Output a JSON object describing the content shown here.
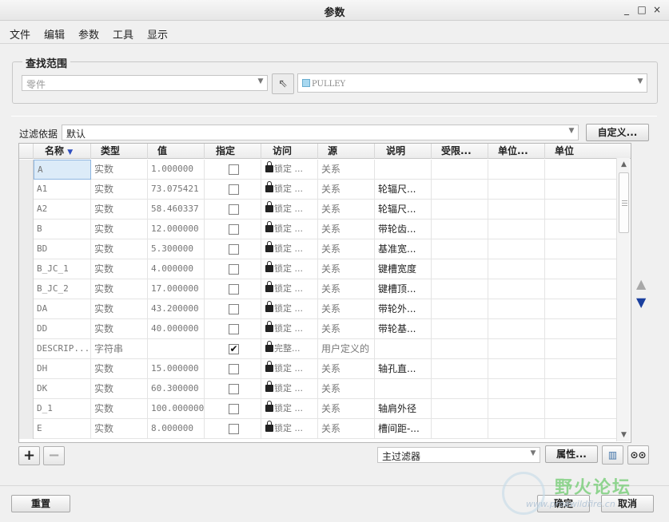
{
  "window": {
    "title": "参数",
    "controls": [
      "_",
      "□",
      "×"
    ]
  },
  "menu": [
    "文件",
    "编辑",
    "参数",
    "工具",
    "显示"
  ],
  "scope": {
    "group_label": "查找范围",
    "type_value": "零件",
    "model_value": "PULLEY"
  },
  "filter": {
    "label": "过滤依据",
    "value": "默认",
    "customize_label": "自定义..."
  },
  "table": {
    "columns": [
      "名称",
      "类型",
      "值",
      "指定",
      "访问",
      "源",
      "说明",
      "受限...",
      "单位...",
      "单位"
    ],
    "rows": [
      {
        "name": "A",
        "type": "实数",
        "value": "1.000000",
        "designate": false,
        "access": "锁定 ...",
        "source": "关系",
        "desc": ""
      },
      {
        "name": "A1",
        "type": "实数",
        "value": "73.075421",
        "designate": false,
        "access": "锁定 ...",
        "source": "关系",
        "desc": "轮辐尺..."
      },
      {
        "name": "A2",
        "type": "实数",
        "value": "58.460337",
        "designate": false,
        "access": "锁定 ...",
        "source": "关系",
        "desc": "轮辐尺..."
      },
      {
        "name": "B",
        "type": "实数",
        "value": "12.000000",
        "designate": false,
        "access": "锁定 ...",
        "source": "关系",
        "desc": "带轮齿..."
      },
      {
        "name": "BD",
        "type": "实数",
        "value": "5.300000",
        "designate": false,
        "access": "锁定 ...",
        "source": "关系",
        "desc": "基准宽..."
      },
      {
        "name": "B_JC_1",
        "type": "实数",
        "value": "4.000000",
        "designate": false,
        "access": "锁定 ...",
        "source": "关系",
        "desc": "键槽宽度"
      },
      {
        "name": "B_JC_2",
        "type": "实数",
        "value": "17.000000",
        "designate": false,
        "access": "锁定 ...",
        "source": "关系",
        "desc": "键槽顶..."
      },
      {
        "name": "DA",
        "type": "实数",
        "value": "43.200000",
        "designate": false,
        "access": "锁定 ...",
        "source": "关系",
        "desc": "带轮外..."
      },
      {
        "name": "DD",
        "type": "实数",
        "value": "40.000000",
        "designate": false,
        "access": "锁定 ...",
        "source": "关系",
        "desc": "带轮基..."
      },
      {
        "name": "DESCRIP...",
        "type": "字符串",
        "value": "",
        "designate": true,
        "access": "完整...",
        "source": "用户定义的",
        "desc": ""
      },
      {
        "name": "DH",
        "type": "实数",
        "value": "15.000000",
        "designate": false,
        "access": "锁定 ...",
        "source": "关系",
        "desc": "轴孔直..."
      },
      {
        "name": "DK",
        "type": "实数",
        "value": "60.300000",
        "designate": false,
        "access": "锁定 ...",
        "source": "关系",
        "desc": ""
      },
      {
        "name": "D_1",
        "type": "实数",
        "value": "100.000000",
        "designate": false,
        "access": "锁定 ...",
        "source": "关系",
        "desc": "轴肩外径"
      },
      {
        "name": "E",
        "type": "实数",
        "value": "8.000000",
        "designate": false,
        "access": "锁定 ...",
        "source": "关系",
        "desc": "槽间距-..."
      }
    ]
  },
  "bottom_tools": {
    "filter_value": "主过滤器",
    "properties_label": "属性..."
  },
  "footer": {
    "reset_label": "重置",
    "ok_label": "确定",
    "cancel_label": "取消"
  },
  "watermark": {
    "text": "野火论坛",
    "url": "www.proewildfire.cn"
  }
}
